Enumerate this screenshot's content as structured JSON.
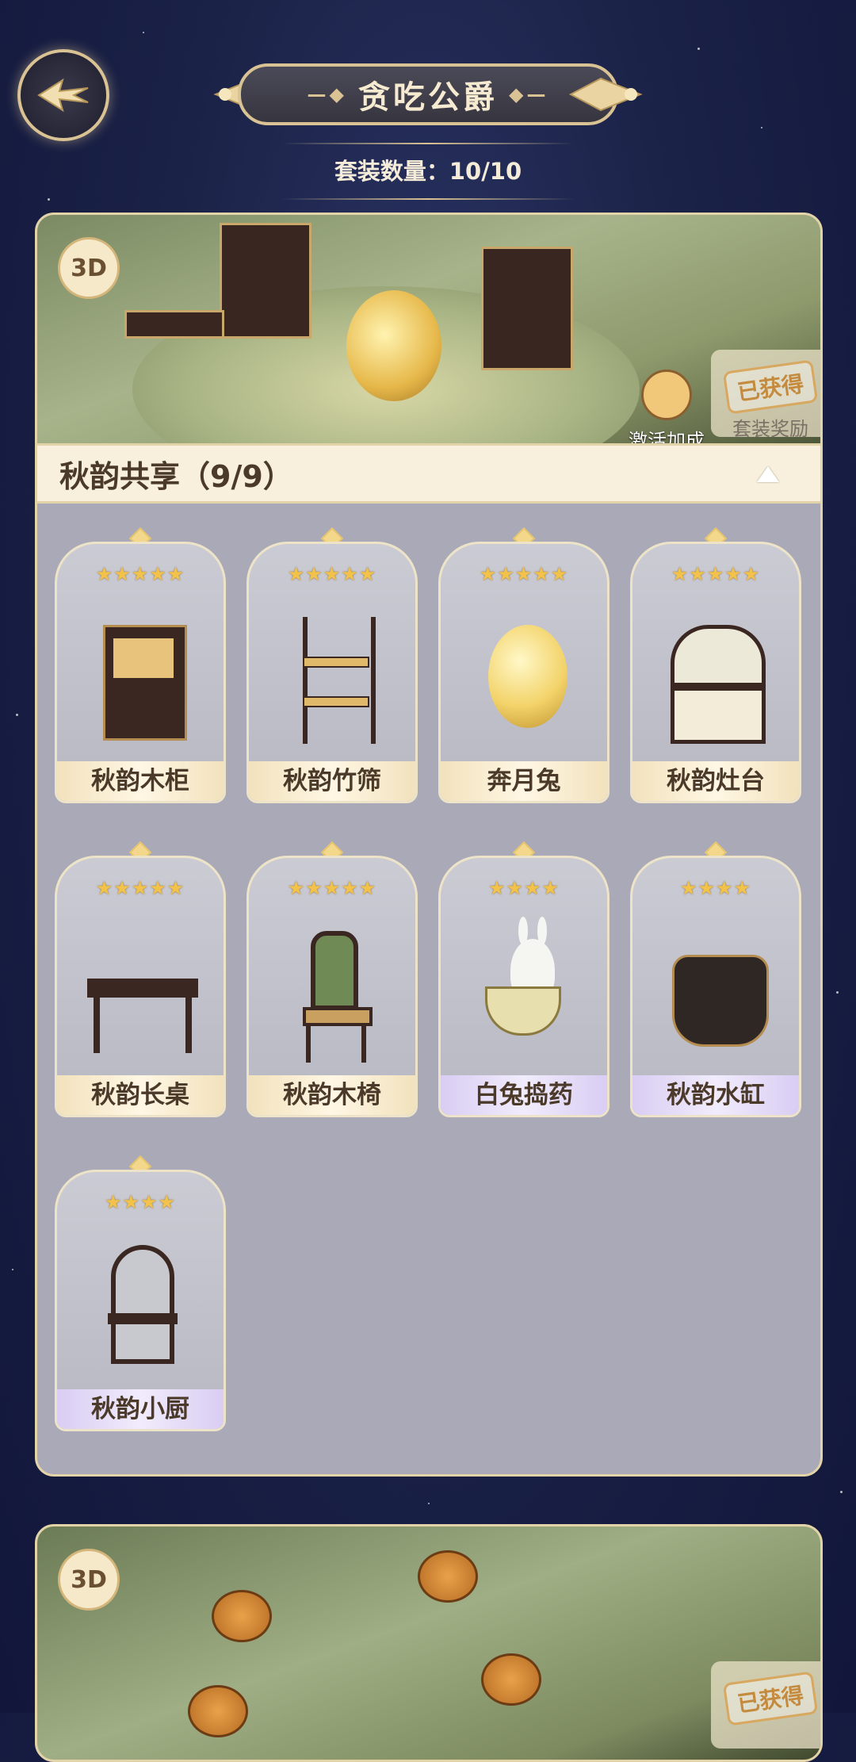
{
  "header": {
    "title": "贪吃公爵",
    "set_count": "套装数量：10/10"
  },
  "set_panel": {
    "badge_3d": "3D",
    "bonus_label": "激活加成",
    "reward_stamp": "已获得",
    "reward_sub": "套装奖励",
    "collapse_title": "秋韵共享（9/9）",
    "items": [
      {
        "name": "秋韵木柜",
        "stars": "★★★★★",
        "rarity": "gold"
      },
      {
        "name": "秋韵竹筛",
        "stars": "★★★★★",
        "rarity": "gold"
      },
      {
        "name": "奔月兔",
        "stars": "★★★★★",
        "rarity": "gold"
      },
      {
        "name": "秋韵灶台",
        "stars": "★★★★★",
        "rarity": "gold"
      },
      {
        "name": "秋韵长桌",
        "stars": "★★★★★",
        "rarity": "gold"
      },
      {
        "name": "秋韵木椅",
        "stars": "★★★★★",
        "rarity": "gold"
      },
      {
        "name": "白兔捣药",
        "stars": "★★★★",
        "rarity": "purple"
      },
      {
        "name": "秋韵水缸",
        "stars": "★★★★",
        "rarity": "purple"
      },
      {
        "name": "秋韵小厨",
        "stars": "★★★★",
        "rarity": "purple"
      }
    ]
  },
  "second_set": {
    "badge_3d": "3D",
    "reward_stamp": "已获得"
  },
  "colors": {
    "background": "#1b2247",
    "gold_border": "#d9c293",
    "panel": "#a9a9b8",
    "star": "#f3c24b"
  }
}
